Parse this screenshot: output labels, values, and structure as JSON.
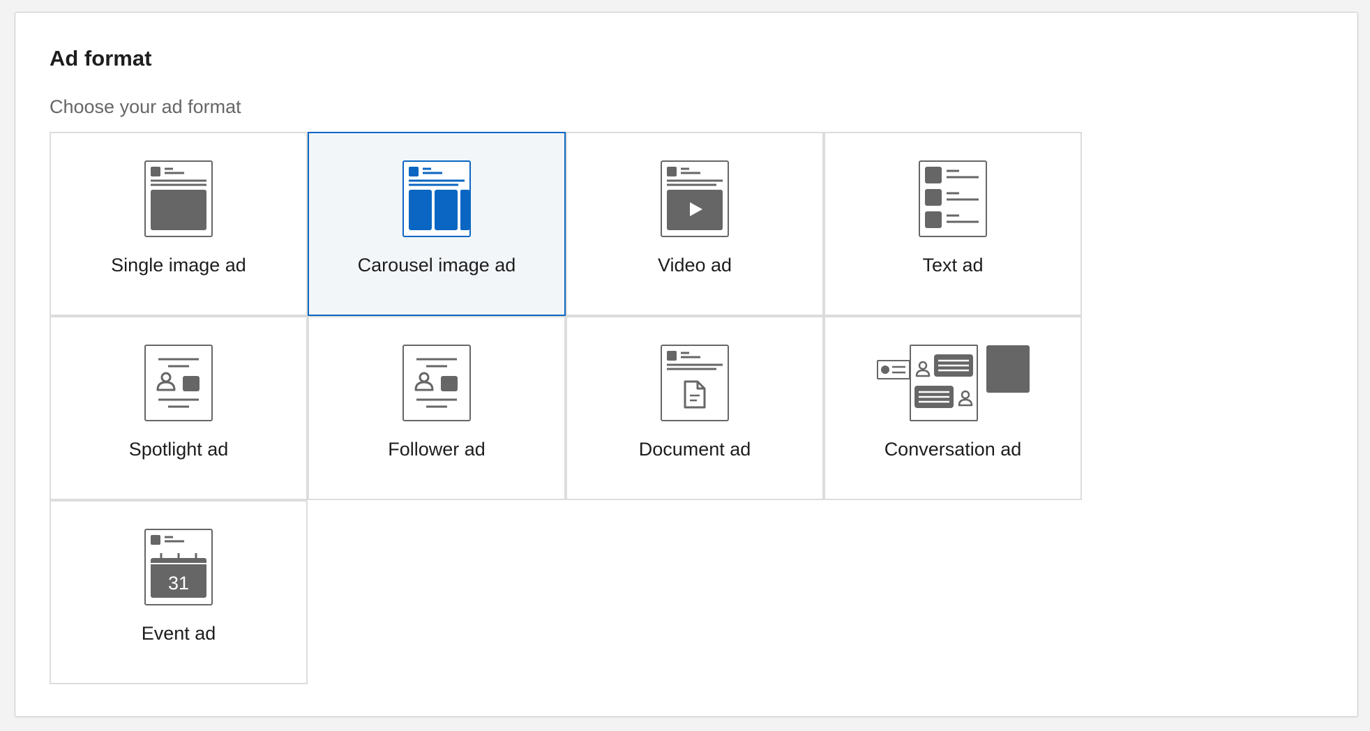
{
  "header": {
    "title": "Ad format",
    "subtitle": "Choose your ad format"
  },
  "colors": {
    "accent": "#0a66c2",
    "icon_gray": "#666666",
    "tile_border": "#dcdcdc",
    "selected_bg": "#f3f6f8"
  },
  "formats": [
    {
      "label": "Single image ad",
      "icon": "single-image-icon",
      "selected": false
    },
    {
      "label": "Carousel image ad",
      "icon": "carousel-image-icon",
      "selected": true
    },
    {
      "label": "Video ad",
      "icon": "video-icon",
      "selected": false
    },
    {
      "label": "Text ad",
      "icon": "text-ad-icon",
      "selected": false
    },
    {
      "label": "Spotlight ad",
      "icon": "spotlight-icon",
      "selected": false
    },
    {
      "label": "Follower ad",
      "icon": "follower-icon",
      "selected": false
    },
    {
      "label": "Document ad",
      "icon": "document-icon",
      "selected": false
    },
    {
      "label": "Conversation ad",
      "icon": "conversation-icon",
      "selected": false
    },
    {
      "label": "Event ad",
      "icon": "event-icon",
      "selected": false,
      "calendar_day": "31"
    }
  ]
}
